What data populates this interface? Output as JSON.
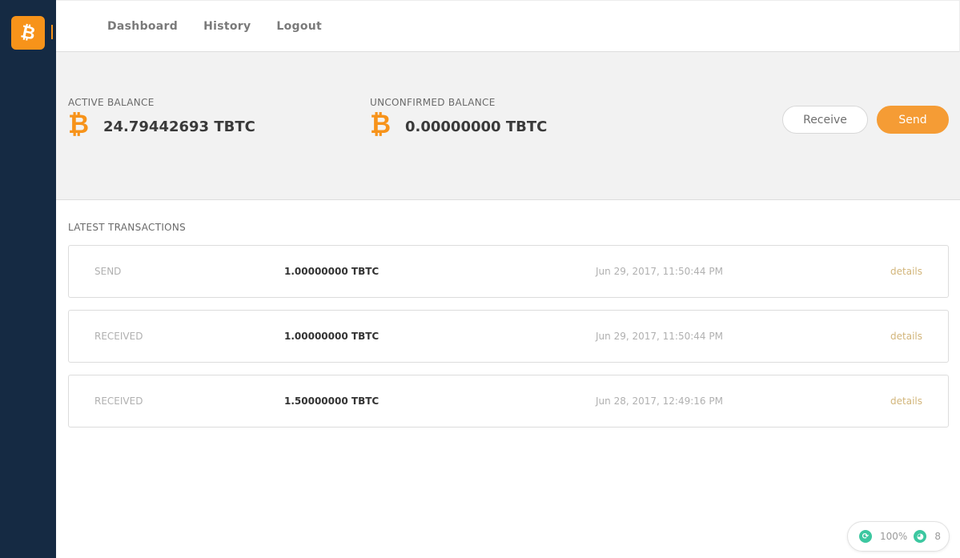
{
  "brand": {
    "logo_glyph": "₿",
    "accent": "#f7931a"
  },
  "nav": {
    "items": [
      {
        "label": "Dashboard"
      },
      {
        "label": "History"
      },
      {
        "label": "Logout"
      }
    ]
  },
  "balances": {
    "active": {
      "label": "ACTIVE BALANCE",
      "icon": "bitcoin-icon",
      "glyph": "₿",
      "amount": "24.79442693 TBTC"
    },
    "unconfirmed": {
      "label": "UNCONFIRMED BALANCE",
      "icon": "bitcoin-icon",
      "glyph": "₿",
      "amount": "0.00000000 TBTC"
    }
  },
  "actions": {
    "receive_label": "Receive",
    "send_label": "Send"
  },
  "transactions": {
    "title": "LATEST TRANSACTIONS",
    "items": [
      {
        "type": "SEND",
        "amount": "1.00000000 TBTC",
        "date": "Jun 29, 2017, 11:50:44 PM",
        "link": "details"
      },
      {
        "type": "RECEIVED",
        "amount": "1.00000000 TBTC",
        "date": "Jun 29, 2017, 11:50:44 PM",
        "link": "details"
      },
      {
        "type": "RECEIVED",
        "amount": "1.50000000 TBTC",
        "date": "Jun 28, 2017, 12:49:16 PM",
        "link": "details"
      }
    ]
  },
  "status": {
    "sync_icon": "sync-icon",
    "sync_glyph": "⟳",
    "sync_percent": "100%",
    "peers_icon": "globe-icon",
    "peers_glyph": "◕",
    "peers_count": "8",
    "color": "#3cc7a0"
  }
}
